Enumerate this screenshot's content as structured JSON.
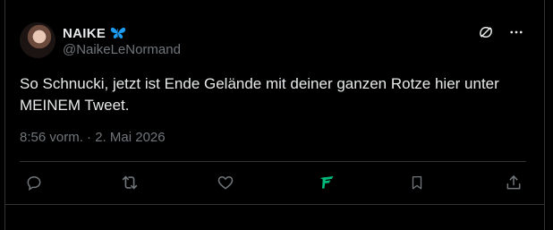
{
  "tweet": {
    "display_name": "NAIKE",
    "verified_icon": "butterfly-icon",
    "handle": "@NaikeLeNormand",
    "text": "So Schnucki, jetzt ist Ende Gelände mit deiner ganzen Rotze hier unter MEINEM Tweet.",
    "time": "8:56 vorm.",
    "separator": "·",
    "date": "2. Mai 2026"
  },
  "top_actions": [
    "grok-icon",
    "more-icon"
  ],
  "actions": [
    "reply-icon",
    "retweet-icon",
    "like-icon",
    "analytics-icon",
    "bookmark-icon",
    "share-icon"
  ],
  "colors": {
    "background": "#000000",
    "text": "#e7e9ea",
    "muted": "#71767b",
    "border": "#2f3336",
    "butterfly": "#1d9bf0",
    "analytics": "#00ba7c"
  }
}
